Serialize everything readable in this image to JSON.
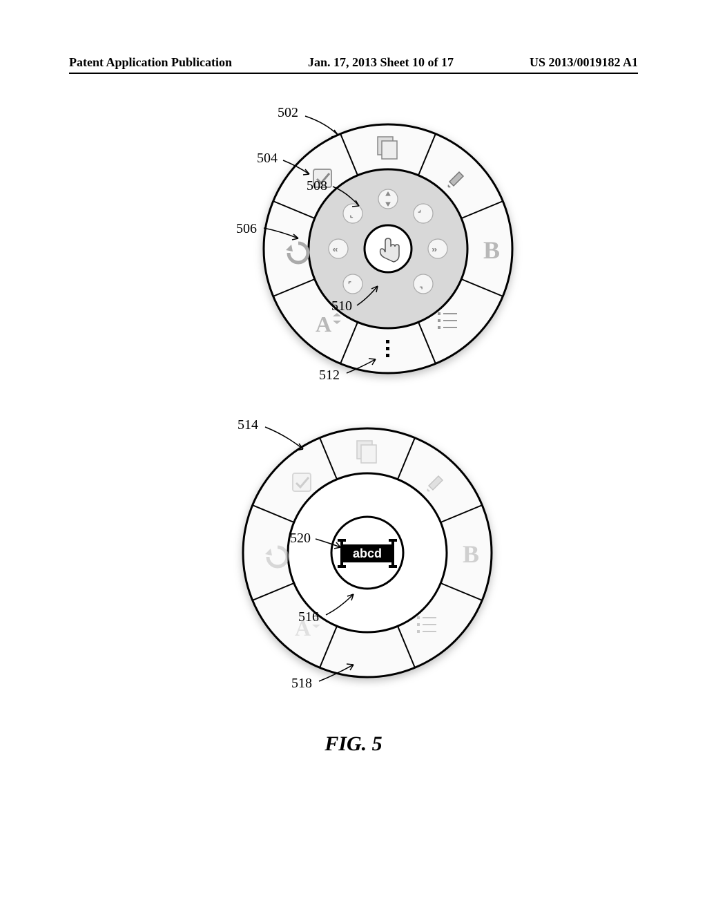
{
  "header": {
    "left": "Patent Application Publication",
    "center": "Jan. 17, 2013  Sheet 10 of 17",
    "right": "US 2013/0019182 A1"
  },
  "labels": {
    "l502": "502",
    "l504": "504",
    "l506": "506",
    "l508": "508",
    "l510": "510",
    "l512": "512",
    "l514": "514",
    "l516": "516",
    "l518": "518",
    "l520": "520"
  },
  "center_text": {
    "abcd": "abcd"
  },
  "outer_icons": {
    "copy": "copy-icon",
    "edit": "edit-icon",
    "paint": "paint-icon",
    "undo": "undo-icon",
    "bold": "B",
    "font": "A",
    "list": "list-icon",
    "more": "more-icon"
  },
  "figure_caption": "FIG. 5"
}
